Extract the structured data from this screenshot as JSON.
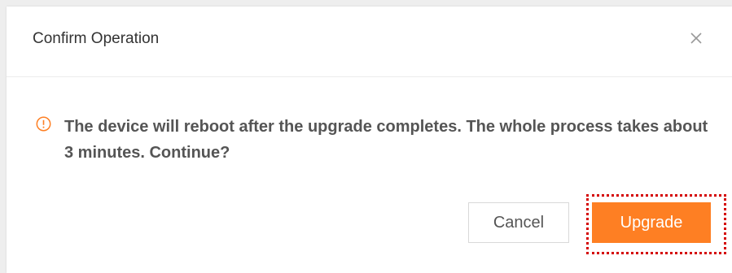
{
  "dialog": {
    "title": "Confirm Operation",
    "message": "The device will reboot after the upgrade completes. The whole process takes about 3 minutes. Continue?",
    "icons": {
      "close": "close-icon",
      "warning": "warning-circle-icon"
    }
  },
  "buttons": {
    "cancel_label": "Cancel",
    "upgrade_label": "Upgrade"
  },
  "colors": {
    "accent": "#fe7f23",
    "warning_icon": "#fe7f23",
    "highlight_border": "#d40000"
  }
}
